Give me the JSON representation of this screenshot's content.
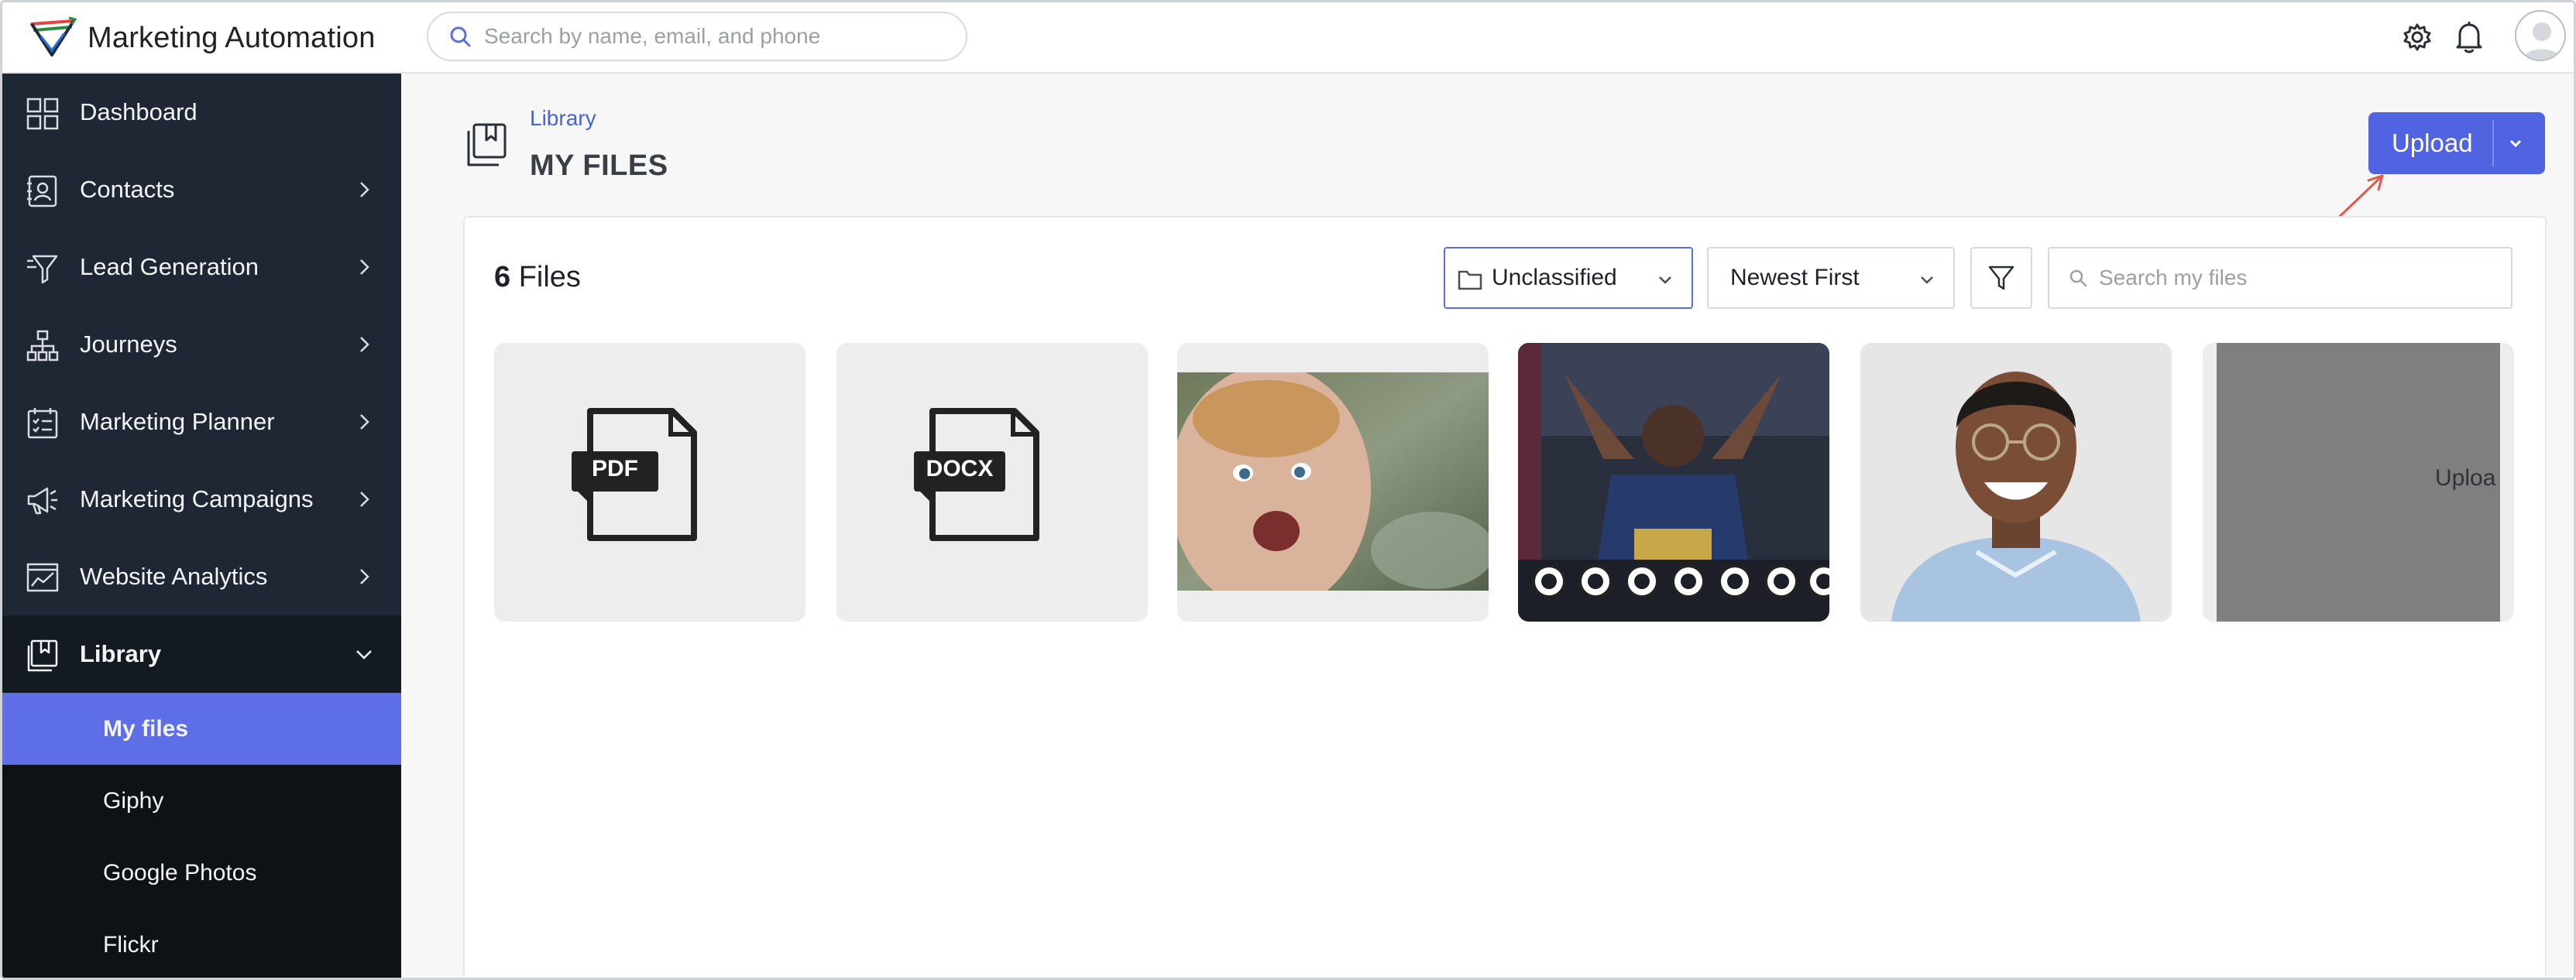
{
  "app": {
    "title": "Marketing Automation"
  },
  "search": {
    "placeholder": "Search by name, email, and phone"
  },
  "sidebar": {
    "items": [
      {
        "label": "Dashboard",
        "icon": "dashboard-icon",
        "has_chevron": false
      },
      {
        "label": "Contacts",
        "icon": "contacts-icon",
        "has_chevron": true
      },
      {
        "label": "Lead Generation",
        "icon": "funnel-icon",
        "has_chevron": true
      },
      {
        "label": "Journeys",
        "icon": "journeys-icon",
        "has_chevron": true
      },
      {
        "label": "Marketing Planner",
        "icon": "planner-icon",
        "has_chevron": true
      },
      {
        "label": "Marketing Campaigns",
        "icon": "megaphone-icon",
        "has_chevron": true
      },
      {
        "label": "Website Analytics",
        "icon": "analytics-icon",
        "has_chevron": true
      },
      {
        "label": "Library",
        "icon": "library-icon",
        "has_chevron": true,
        "expanded": true
      }
    ],
    "library_sub": [
      {
        "label": "My files",
        "active": true
      },
      {
        "label": "Giphy"
      },
      {
        "label": "Google Photos"
      },
      {
        "label": "Flickr"
      }
    ]
  },
  "main": {
    "breadcrumb": "Library",
    "title": "MY FILES",
    "upload_label": "Upload",
    "file_count_number": "6",
    "file_count_label": "Files",
    "folder_select": "Unclassified",
    "sort_select": "Newest First",
    "file_search_placeholder": "Search my files",
    "cards": [
      {
        "kind": "document",
        "badge": "PDF"
      },
      {
        "kind": "document",
        "badge": "DOCX"
      },
      {
        "kind": "image",
        "subject": "crying baby"
      },
      {
        "kind": "image",
        "subject": "fighter celebrating"
      },
      {
        "kind": "image",
        "subject": "smiling man with glasses"
      },
      {
        "kind": "uploading",
        "text": "Uploa"
      }
    ]
  },
  "colors": {
    "sidebar_bg": "#1e2733",
    "active_item": "#5e6ee6",
    "accent": "#5063e0",
    "arrow": "#e5574a"
  }
}
